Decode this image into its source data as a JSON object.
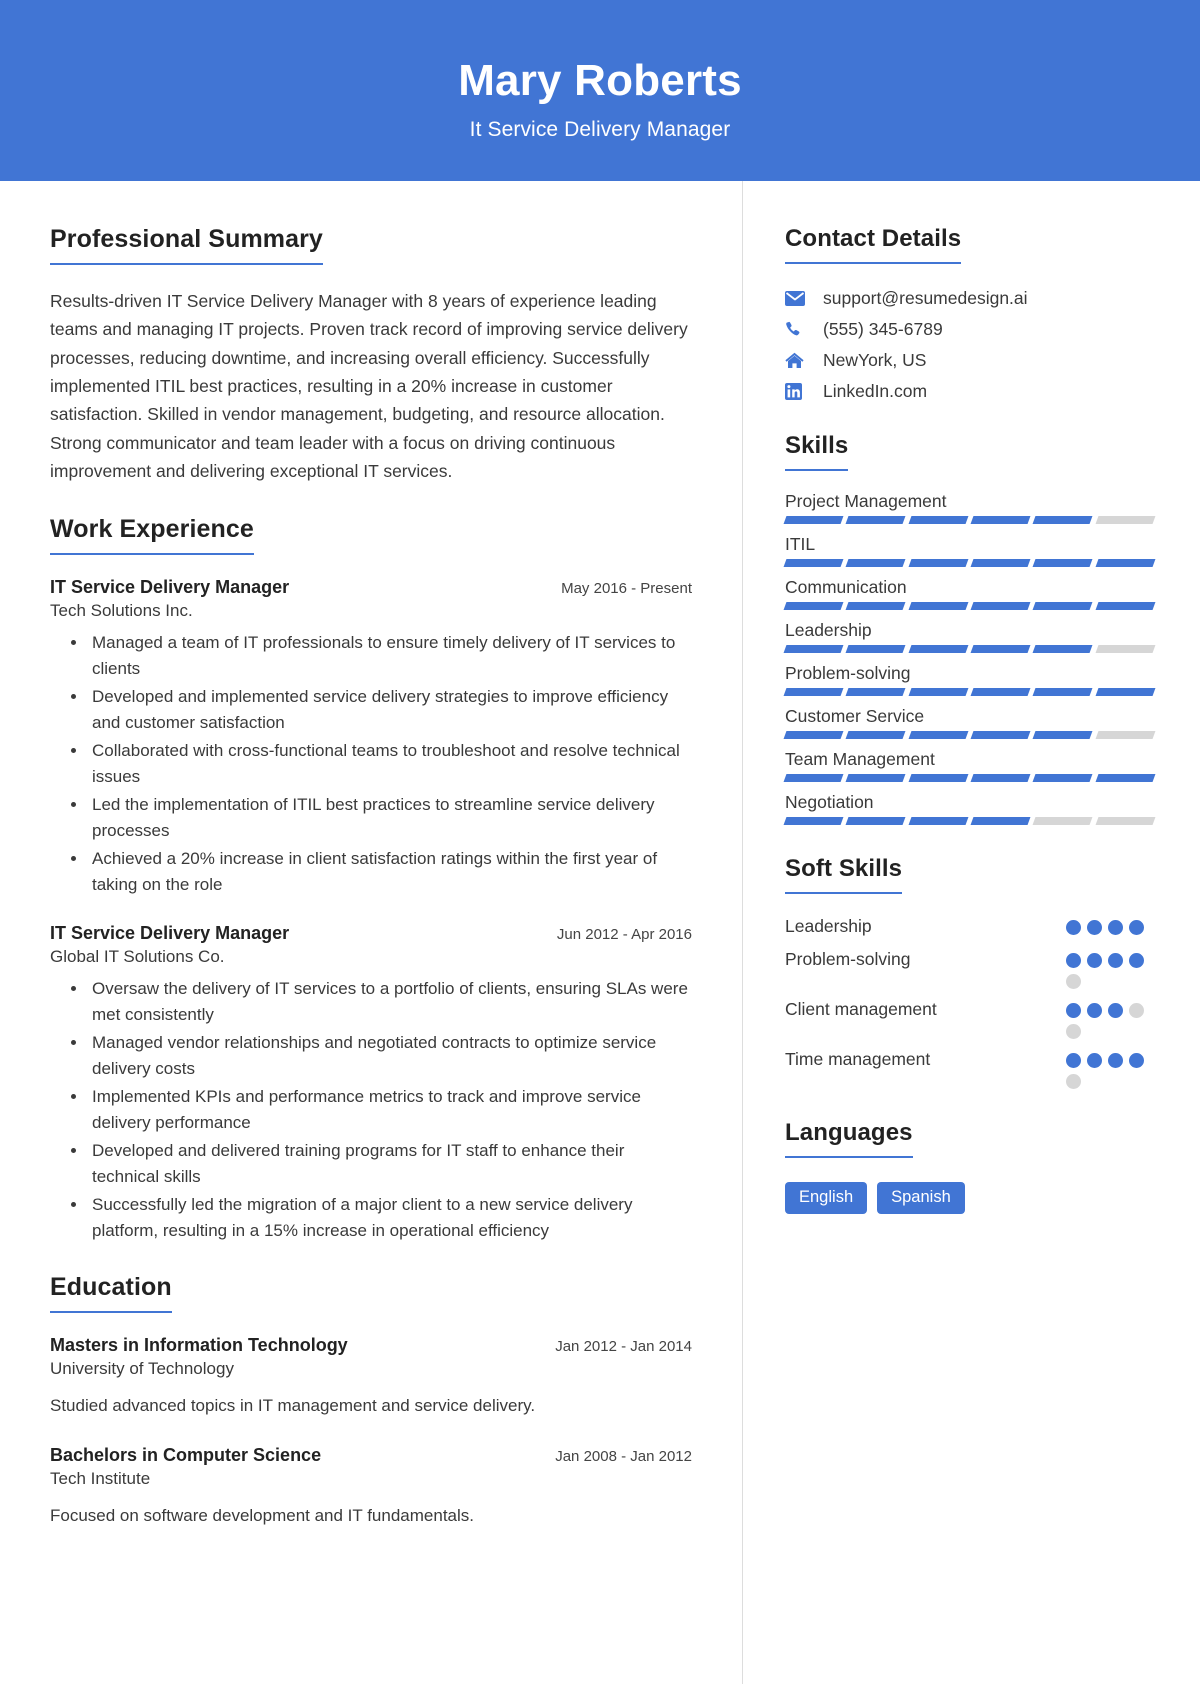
{
  "header": {
    "name": "Mary Roberts",
    "role": "It Service Delivery Manager",
    "bg_color": "#4175d4"
  },
  "accent_color": "#4175d4",
  "left": {
    "summary": {
      "title": "Professional Summary",
      "text": "Results-driven IT Service Delivery Manager with 8 years of experience leading teams and managing IT projects. Proven track record of improving service delivery processes, reducing downtime, and increasing overall efficiency. Successfully implemented ITIL best practices, resulting in a 20% increase in customer satisfaction. Skilled in vendor management, budgeting, and resource allocation. Strong communicator and team leader with a focus on driving continuous improvement and delivering exceptional IT services."
    },
    "work": {
      "title": "Work Experience",
      "entries": [
        {
          "title": "IT Service Delivery Manager",
          "date": "May 2016 - Present",
          "org": "Tech Solutions Inc.",
          "bullets": [
            "Managed a team of IT professionals to ensure timely delivery of IT services to clients",
            "Developed and implemented service delivery strategies to improve efficiency and customer satisfaction",
            "Collaborated with cross-functional teams to troubleshoot and resolve technical issues",
            "Led the implementation of ITIL best practices to streamline service delivery processes",
            "Achieved a 20% increase in client satisfaction ratings within the first year of taking on the role"
          ]
        },
        {
          "title": "IT Service Delivery Manager",
          "date": "Jun 2012 - Apr 2016",
          "org": "Global IT Solutions Co.",
          "bullets": [
            "Oversaw the delivery of IT services to a portfolio of clients, ensuring SLAs were met consistently",
            "Managed vendor relationships and negotiated contracts to optimize service delivery costs",
            "Implemented KPIs and performance metrics to track and improve service delivery performance",
            "Developed and delivered training programs for IT staff to enhance their technical skills",
            "Successfully led the migration of a major client to a new service delivery platform, resulting in a 15% increase in operational efficiency"
          ]
        }
      ]
    },
    "education": {
      "title": "Education",
      "entries": [
        {
          "title": "Masters in Information Technology",
          "date": "Jan 2012 - Jan 2014",
          "org": "University of Technology",
          "desc": "Studied advanced topics in IT management and service delivery."
        },
        {
          "title": "Bachelors in Computer Science",
          "date": "Jan 2008 - Jan 2012",
          "org": "Tech Institute",
          "desc": "Focused on software development and IT fundamentals."
        }
      ]
    }
  },
  "right": {
    "contact": {
      "title": "Contact Details",
      "items": [
        {
          "icon": "email-icon",
          "value": "support@resumedesign.ai"
        },
        {
          "icon": "phone-icon",
          "value": "(555) 345-6789"
        },
        {
          "icon": "home-icon",
          "value": "NewYork, US"
        },
        {
          "icon": "linkedin-icon",
          "value": "LinkedIn.com"
        }
      ]
    },
    "skills": {
      "title": "Skills",
      "segments_total": 6,
      "items": [
        {
          "label": "Project Management",
          "filled": 5
        },
        {
          "label": "ITIL",
          "filled": 6
        },
        {
          "label": "Communication",
          "filled": 6
        },
        {
          "label": "Leadership",
          "filled": 5
        },
        {
          "label": "Problem-solving",
          "filled": 6
        },
        {
          "label": "Customer Service",
          "filled": 5
        },
        {
          "label": "Team Management",
          "filled": 6
        },
        {
          "label": "Negotiation",
          "filled": 4
        }
      ]
    },
    "soft_skills": {
      "title": "Soft Skills",
      "dots_total": 4,
      "items": [
        {
          "label": "Leadership",
          "filled": 4,
          "total": 4
        },
        {
          "label": "Problem-solving",
          "filled": 4,
          "total": 5
        },
        {
          "label": "Client management",
          "filled": 3,
          "total": 5
        },
        {
          "label": "Time management",
          "filled": 4,
          "total": 5
        }
      ]
    },
    "languages": {
      "title": "Languages",
      "items": [
        "English",
        "Spanish"
      ]
    }
  }
}
